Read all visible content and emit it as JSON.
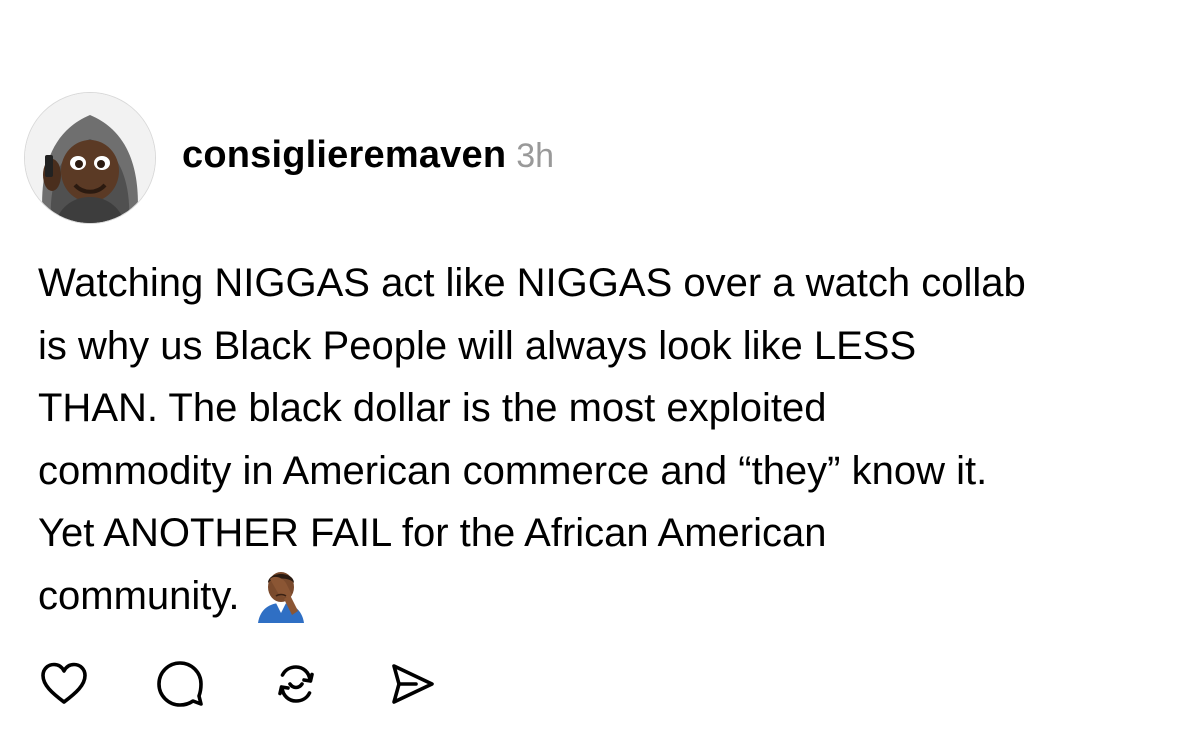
{
  "post": {
    "author": {
      "username": "consiglieremaven",
      "avatar_icon": "avatar-hooded-man"
    },
    "time_ago": "3h",
    "text_lines": [
      "Watching NIGGAS act like NIGGAS over a watch collab",
      "is why us Black People will always look like LESS",
      "THAN. The black dollar is the most exploited",
      "commodity in American commerce and “they” know it.",
      "Yet ANOTHER FAIL for the African American",
      "community."
    ],
    "trailing_emoji": "man-facepalming-emoji"
  },
  "actions": {
    "like_icon": "heart-icon",
    "reply_icon": "comment-bubble-icon",
    "repost_icon": "repost-icon",
    "share_icon": "send-icon"
  },
  "colors": {
    "text": "#000000",
    "secondary": "#999999",
    "background": "#ffffff"
  }
}
